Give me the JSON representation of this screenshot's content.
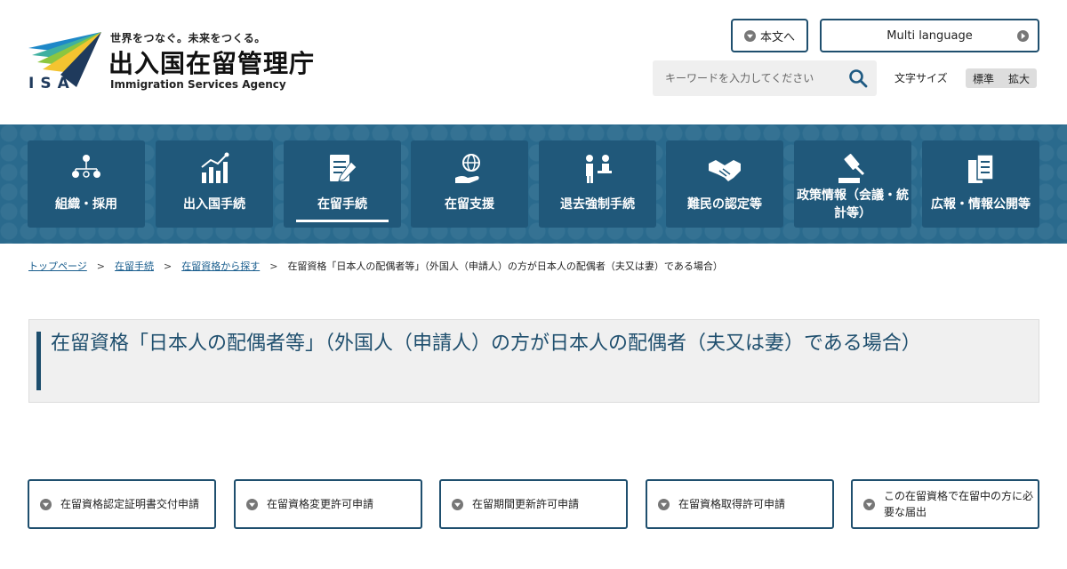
{
  "header": {
    "logo_isa": "ISA",
    "tagline": "世界をつなぐ。未来をつくる。",
    "agency_name_ja": "出入国在留管理庁",
    "agency_name_en": "Immigration Services Agency",
    "main_content_button": "本文へ",
    "multi_language_button": "Multi language",
    "search": {
      "placeholder": "キーワードを入力してください",
      "value": ""
    },
    "font_size": {
      "label": "文字サイズ",
      "standard": "標準",
      "large": "拡大"
    }
  },
  "nav": {
    "items": [
      {
        "label": "組織・採用",
        "icon": "organization-icon"
      },
      {
        "label": "出入国手続",
        "icon": "chart-icon"
      },
      {
        "label": "在留手続",
        "icon": "document-edit-icon",
        "active": true
      },
      {
        "label": "在留支援",
        "icon": "globe-hand-icon"
      },
      {
        "label": "退去強制手続",
        "icon": "people-desk-icon"
      },
      {
        "label": "難民の認定等",
        "icon": "handshake-icon"
      },
      {
        "label": "政策情報（会議・統計等）",
        "icon": "gavel-icon"
      },
      {
        "label": "広報・情報公開等",
        "icon": "documents-icon"
      }
    ]
  },
  "breadcrumb": {
    "items": [
      "トップページ",
      "在留手続",
      "在留資格から探す"
    ],
    "current": "在留資格「日本人の配偶者等」（外国人（申請人）の方が日本人の配偶者（夫又は妻）である場合）"
  },
  "page_title": "在留資格「日本人の配偶者等」（外国人（申請人）の方が日本人の配偶者（夫又は妻）である場合）",
  "procedures": [
    "在留資格認定証明書交付申請",
    "在留資格変更許可申請",
    "在留期間更新許可申請",
    "在留資格取得許可申請",
    "この在留資格で在留中の方に必要な届出"
  ],
  "colors": {
    "brand_navy": "#1f4f6e",
    "nav_background": "#2a6a8d",
    "nav_tile": "#20587a",
    "link": "#1a5e8e"
  }
}
